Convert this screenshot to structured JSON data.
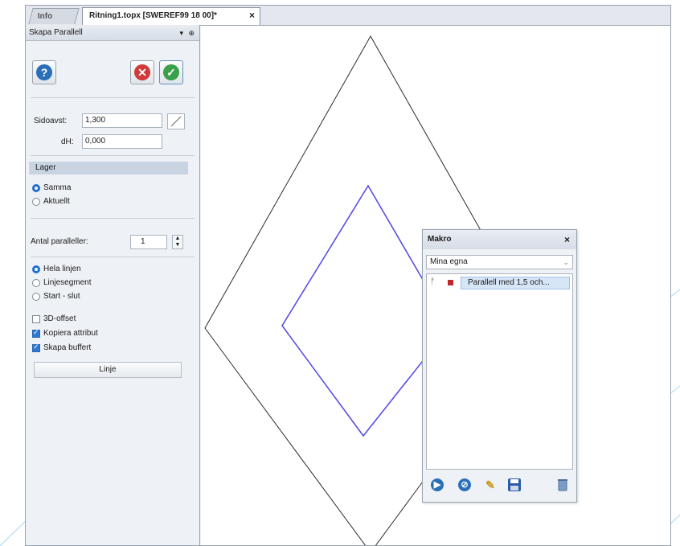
{
  "tabs": [
    {
      "label": "Info",
      "active": false
    },
    {
      "label": "Ritning1.topx [SWEREF99 18 00]*",
      "active": true
    }
  ],
  "tab_close_glyph": "×",
  "panel": {
    "title": "Skapa Parallell",
    "pin_glyph": "▾  ⊕",
    "help_icon": "help-icon",
    "cancel_icon": "cancel-icon",
    "ok_icon": "ok-icon",
    "sidoavstand_label": "Sidoavst:",
    "sidoavstand_value": "1,300",
    "dh_label": "dH:",
    "dh_value": "0,000",
    "lager_header": "Lager",
    "lager_options": [
      "Samma",
      "Aktuellt"
    ],
    "lager_selected": "Samma",
    "antal_label": "Antal paralleller:",
    "antal_value": "1",
    "mode_options": [
      "Hela linjen",
      "Linjesegment",
      "Start - slut"
    ],
    "mode_selected": "Hela linjen",
    "checkboxes": [
      {
        "label": "3D-offset",
        "checked": false
      },
      {
        "label": "Kopiera attribut",
        "checked": true
      },
      {
        "label": "Skapa buffert",
        "checked": true
      }
    ],
    "type_button": "Linje"
  },
  "makro": {
    "title": "Makro",
    "close_glyph": "×",
    "dropdown_value": "Mina egna",
    "items": [
      {
        "label": "Parallell med 1,5 och..."
      }
    ]
  },
  "colors": {
    "accent": "#1f6fd0",
    "inner_shape": "#5a4ee6",
    "outer_shape": "#2b2b2b",
    "item_marker": "#c0282d"
  }
}
